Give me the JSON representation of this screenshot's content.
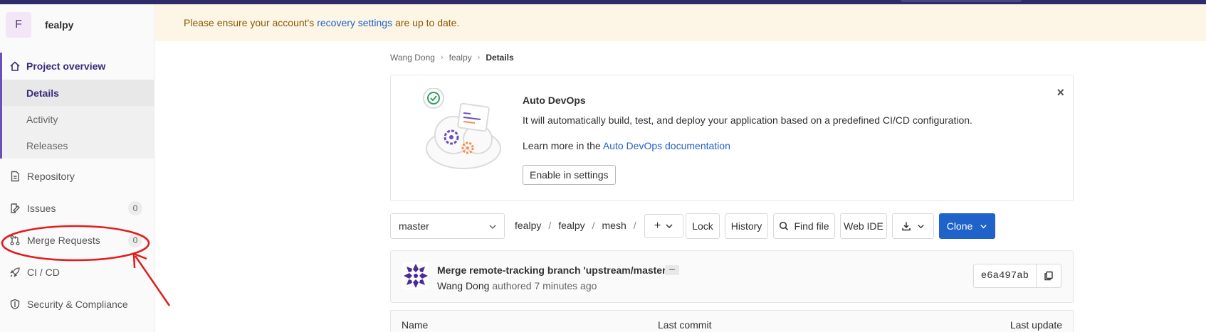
{
  "project": {
    "avatar_letter": "F",
    "name": "fealpy"
  },
  "sidebar": {
    "overview": "Project overview",
    "sub_items": [
      "Details",
      "Activity",
      "Releases"
    ],
    "items": [
      {
        "label": "Repository"
      },
      {
        "label": "Issues",
        "count": "0"
      },
      {
        "label": "Merge Requests",
        "count": "0"
      },
      {
        "label": "CI / CD"
      },
      {
        "label": "Security & Compliance"
      }
    ]
  },
  "alert": {
    "before": "Please ensure your account's",
    "link": "recovery settings",
    "after": "are up to date."
  },
  "breadcrumb": [
    "Wang Dong",
    "fealpy",
    "Details"
  ],
  "devops": {
    "title": "Auto DevOps",
    "description": "It will automatically build, test, and deploy your application based on a predefined CI/CD configuration.",
    "learn_prefix": "Learn more in the",
    "learn_link": "Auto DevOps documentation",
    "enable_button": "Enable in settings",
    "close": "×"
  },
  "repo": {
    "branch": "master",
    "path": [
      "fealpy",
      "fealpy",
      "mesh"
    ],
    "add": "+",
    "buttons": {
      "lock": "Lock",
      "history": "History",
      "find_file": "Find file",
      "web_ide": "Web IDE",
      "clone": "Clone"
    }
  },
  "commit": {
    "message": "Merge remote-tracking branch 'upstream/master'",
    "ellipsis": "...",
    "author": "Wang Dong",
    "meta": "authored 7 minutes ago",
    "sha": "e6a497ab"
  },
  "files": {
    "headers": [
      "Name",
      "Last commit",
      "Last update"
    ]
  },
  "colors": {
    "brand": "#2f2a6b",
    "accent": "#6b4fbb",
    "link": "#1f62c9",
    "annotation": "#e31b1b"
  }
}
